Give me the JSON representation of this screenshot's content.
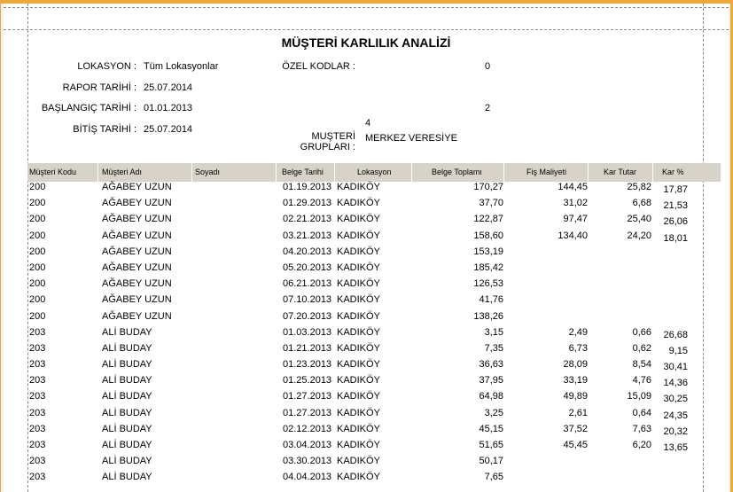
{
  "report": {
    "title": "MÜŞTERİ KARLILIK ANALİZİ",
    "lokasyon_label": "LOKASYON :",
    "lokasyon_value": "Tüm Lokasyonlar",
    "rapor_tarihi_label": "RAPOR TARİHİ :",
    "rapor_tarihi_value": "25.07.2014",
    "baslangic_label": "BAŞLANGIÇ TARİHİ :",
    "baslangic_value": "01.01.2013",
    "bitis_label": "BİTİŞ TARİHİ :",
    "bitis_value": "25.07.2014",
    "ozel_kodlar_label": "ÖZEL KODLAR :",
    "ozel_kodlar_value_1": "0",
    "ozel_kodlar_value_2": "2",
    "grup_count": "4",
    "musteri_gruplari_label_1": "MUŞTERİ",
    "musteri_gruplari_label_2": "GRUPLARI :",
    "musteri_gruplari_value": "MERKEZ VERESİYE"
  },
  "table": {
    "headers": {
      "kod": "Müşteri Kodu",
      "adi": "Müşteri Adı",
      "soyadi": "Soyadı",
      "tarih": "Belge Tarihi",
      "lokasyon": "Lokasyon",
      "toplam": "Belge Toplamı",
      "maliyet": "Fiş Maliyeti",
      "kar_tutar": "Kar Tutar",
      "kar_yuzde": "Kar %"
    },
    "rows": [
      {
        "kod": "200",
        "adi": "AĞABEY UZUN",
        "tarih": "01.19.2013",
        "lokasyon": "KADIKÖY",
        "toplam": "170,27",
        "maliyet": "144,45",
        "kar_tutar": "25,82",
        "kar_yuzde": "17,87"
      },
      {
        "kod": "200",
        "adi": "AĞABEY UZUN",
        "tarih": "01.29.2013",
        "lokasyon": "KADIKÖY",
        "toplam": "37,70",
        "maliyet": "31,02",
        "kar_tutar": "6,68",
        "kar_yuzde": "21,53"
      },
      {
        "kod": "200",
        "adi": "AĞABEY UZUN",
        "tarih": "02.21.2013",
        "lokasyon": "KADIKÖY",
        "toplam": "122,87",
        "maliyet": "97,47",
        "kar_tutar": "25,40",
        "kar_yuzde": "26,06"
      },
      {
        "kod": "200",
        "adi": "AĞABEY UZUN",
        "tarih": "03.21.2013",
        "lokasyon": "KADIKÖY",
        "toplam": "158,60",
        "maliyet": "134,40",
        "kar_tutar": "24,20",
        "kar_yuzde": "18,01"
      },
      {
        "kod": "200",
        "adi": "AĞABEY UZUN",
        "tarih": "04.20.2013",
        "lokasyon": "KADIKÖY",
        "toplam": "153,19",
        "maliyet": "",
        "kar_tutar": "",
        "kar_yuzde": ""
      },
      {
        "kod": "200",
        "adi": "AĞABEY UZUN",
        "tarih": "05.20.2013",
        "lokasyon": "KADIKÖY",
        "toplam": "185,42",
        "maliyet": "",
        "kar_tutar": "",
        "kar_yuzde": ""
      },
      {
        "kod": "200",
        "adi": "AĞABEY UZUN",
        "tarih": "06.21.2013",
        "lokasyon": "KADIKÖY",
        "toplam": "126,53",
        "maliyet": "",
        "kar_tutar": "",
        "kar_yuzde": ""
      },
      {
        "kod": "200",
        "adi": "AĞABEY UZUN",
        "tarih": "07.10.2013",
        "lokasyon": "KADIKÖY",
        "toplam": "41,76",
        "maliyet": "",
        "kar_tutar": "",
        "kar_yuzde": ""
      },
      {
        "kod": "200",
        "adi": "AĞABEY UZUN",
        "tarih": "07.20.2013",
        "lokasyon": "KADIKÖY",
        "toplam": "138,26",
        "maliyet": "",
        "kar_tutar": "",
        "kar_yuzde": ""
      },
      {
        "kod": "203",
        "adi": "ALİ BUDAY",
        "tarih": "01.03.2013",
        "lokasyon": "KADIKÖY",
        "toplam": "3,15",
        "maliyet": "2,49",
        "kar_tutar": "0,66",
        "kar_yuzde": "26,68"
      },
      {
        "kod": "203",
        "adi": "ALİ BUDAY",
        "tarih": "01.21.2013",
        "lokasyon": "KADIKÖY",
        "toplam": "7,35",
        "maliyet": "6,73",
        "kar_tutar": "0,62",
        "kar_yuzde": "9,15"
      },
      {
        "kod": "203",
        "adi": "ALİ BUDAY",
        "tarih": "01.23.2013",
        "lokasyon": "KADIKÖY",
        "toplam": "36,63",
        "maliyet": "28,09",
        "kar_tutar": "8,54",
        "kar_yuzde": "30,41"
      },
      {
        "kod": "203",
        "adi": "ALİ BUDAY",
        "tarih": "01.25.2013",
        "lokasyon": "KADIKÖY",
        "toplam": "37,95",
        "maliyet": "33,19",
        "kar_tutar": "4,76",
        "kar_yuzde": "14,36"
      },
      {
        "kod": "203",
        "adi": "ALİ BUDAY",
        "tarih": "01.27.2013",
        "lokasyon": "KADIKÖY",
        "toplam": "64,98",
        "maliyet": "49,89",
        "kar_tutar": "15,09",
        "kar_yuzde": "30,25"
      },
      {
        "kod": "203",
        "adi": "ALİ BUDAY",
        "tarih": "01.27.2013",
        "lokasyon": "KADIKÖY",
        "toplam": "3,25",
        "maliyet": "2,61",
        "kar_tutar": "0,64",
        "kar_yuzde": "24,35"
      },
      {
        "kod": "203",
        "adi": "ALİ BUDAY",
        "tarih": "02.12.2013",
        "lokasyon": "KADIKÖY",
        "toplam": "45,15",
        "maliyet": "37,52",
        "kar_tutar": "7,63",
        "kar_yuzde": "20,32"
      },
      {
        "kod": "203",
        "adi": "ALİ BUDAY",
        "tarih": "03.04.2013",
        "lokasyon": "KADIKÖY",
        "toplam": "51,65",
        "maliyet": "45,45",
        "kar_tutar": "6,20",
        "kar_yuzde": "13,65"
      },
      {
        "kod": "203",
        "adi": "ALİ BUDAY",
        "tarih": "03.30.2013",
        "lokasyon": "KADIKÖY",
        "toplam": "50,17",
        "maliyet": "",
        "kar_tutar": "",
        "kar_yuzde": ""
      },
      {
        "kod": "203",
        "adi": "ALİ BUDAY",
        "tarih": "04.04.2013",
        "lokasyon": "KADIKÖY",
        "toplam": "7,65",
        "maliyet": "",
        "kar_tutar": "",
        "kar_yuzde": ""
      }
    ]
  }
}
